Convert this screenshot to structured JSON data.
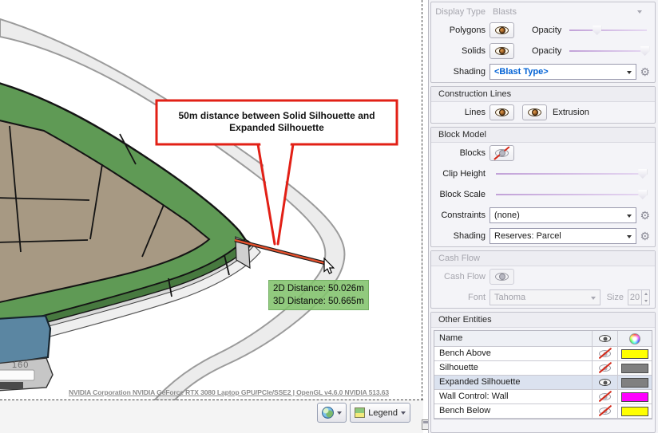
{
  "viewport": {
    "callout": {
      "line1": "50m distance between Solid Silhouette and",
      "line2": "Expanded Silhouette"
    },
    "measurement": {
      "d2": "2D Distance: 50.026m",
      "d3": "3D Distance: 50.665m"
    },
    "bench_label": "160",
    "status_text": "NVIDIA Corporation NVIDIA GeForce RTX 3080 Laptop GPU/PCIe/SSE2 | OpenGL v4.6.0 NVIDIA 513.63",
    "legend_button": "Legend",
    "scene_colors": {
      "bench_top": "#5f9a55",
      "bench_side": "#47793f",
      "blast_area": "#a79983",
      "silhouette_band": "#ececec",
      "water_block": "#5b86a2",
      "measure_line": "#e8512d",
      "callout_red": "#e22016",
      "tooltip_green": "#82c36c"
    }
  },
  "panel": {
    "display": {
      "label": "Display Type",
      "value": "Blasts",
      "polygons": "Polygons",
      "solids": "Solids",
      "opacity": "Opacity",
      "shading": "Shading",
      "shading_value": "<Blast Type>",
      "polygons_opacity_pct": 35,
      "solids_opacity_pct": 97
    },
    "construction": {
      "title": "Construction Lines",
      "lines": "Lines",
      "extrusion": "Extrusion"
    },
    "block_model": {
      "title": "Block Model",
      "blocks": "Blocks",
      "clip_height": "Clip Height",
      "block_scale": "Block Scale",
      "clip_height_pct": 97,
      "block_scale_pct": 97,
      "constraints": "Constraints",
      "constraints_value": "(none)",
      "shading": "Shading",
      "shading_value": "Reserves: Parcel"
    },
    "cash_flow": {
      "title": "Cash Flow",
      "label": "Cash Flow",
      "font": "Font",
      "font_value": "Tahoma",
      "size": "Size",
      "size_value": "20"
    },
    "other_entities": {
      "title": "Other Entities",
      "name_header": "Name",
      "rows": [
        {
          "name": "Bench Above",
          "visible": false,
          "color": "#ffff00"
        },
        {
          "name": "Silhouette",
          "visible": false,
          "color": "#808080"
        },
        {
          "name": "Expanded Silhouette",
          "visible": true,
          "color": "#808080",
          "selected": true
        },
        {
          "name": "Wall Control: Wall",
          "visible": false,
          "color": "#ff00ff"
        },
        {
          "name": "Bench Below",
          "visible": false,
          "color": "#ffff00"
        }
      ]
    }
  },
  "icons": {
    "gear": "⚙"
  }
}
